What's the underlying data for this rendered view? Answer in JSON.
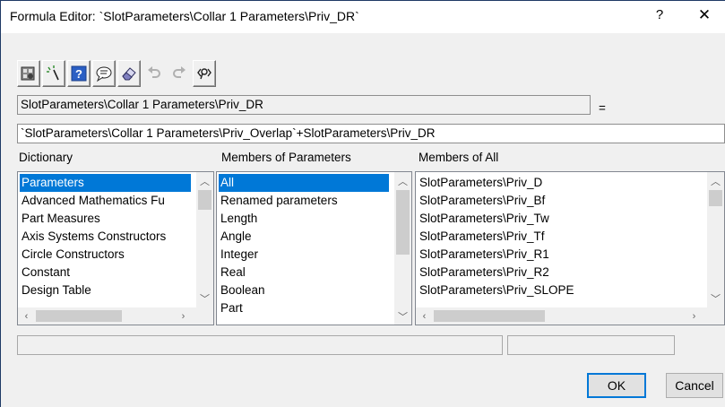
{
  "window": {
    "title": "Formula Editor: `SlotParameters\\Collar 1 Parameters\\Priv_DR`",
    "help_label": "?",
    "close_label": "✕"
  },
  "toolbar": {
    "icons": [
      "settings-icon",
      "magic-wand-icon",
      "help-icon",
      "speech-bubble-icon",
      "eraser-icon",
      "undo-icon",
      "redo-icon",
      "search-icon"
    ]
  },
  "parameter": {
    "name": "SlotParameters\\Collar 1 Parameters\\Priv_DR",
    "equals": "="
  },
  "formula": {
    "value": "`SlotParameters\\Collar 1 Parameters\\Priv_Overlap`+SlotParameters\\Priv_DR"
  },
  "dictionary": {
    "header": "Dictionary",
    "items": [
      "Parameters",
      "Advanced Mathematics Fu",
      "Part Measures",
      "Axis Systems Constructors",
      "Circle Constructors",
      "Constant",
      "Design Table"
    ],
    "selected_index": 0
  },
  "members_of_parameters": {
    "header": "Members of Parameters",
    "items": [
      "All",
      "Renamed parameters",
      "Length",
      "Angle",
      "Integer",
      "Real",
      "Boolean",
      "Part"
    ],
    "selected_index": 0
  },
  "members_of_all": {
    "header": "Members of All",
    "items": [
      "SlotParameters\\Priv_D",
      "SlotParameters\\Priv_Bf",
      "SlotParameters\\Priv_Tw",
      "SlotParameters\\Priv_Tf",
      "SlotParameters\\Priv_R1",
      "SlotParameters\\Priv_R2",
      "SlotParameters\\Priv_SLOPE"
    ]
  },
  "buttons": {
    "ok": "OK",
    "cancel": "Cancel"
  },
  "colors": {
    "selection": "#0078d7",
    "window_border": "#1f3a66"
  }
}
